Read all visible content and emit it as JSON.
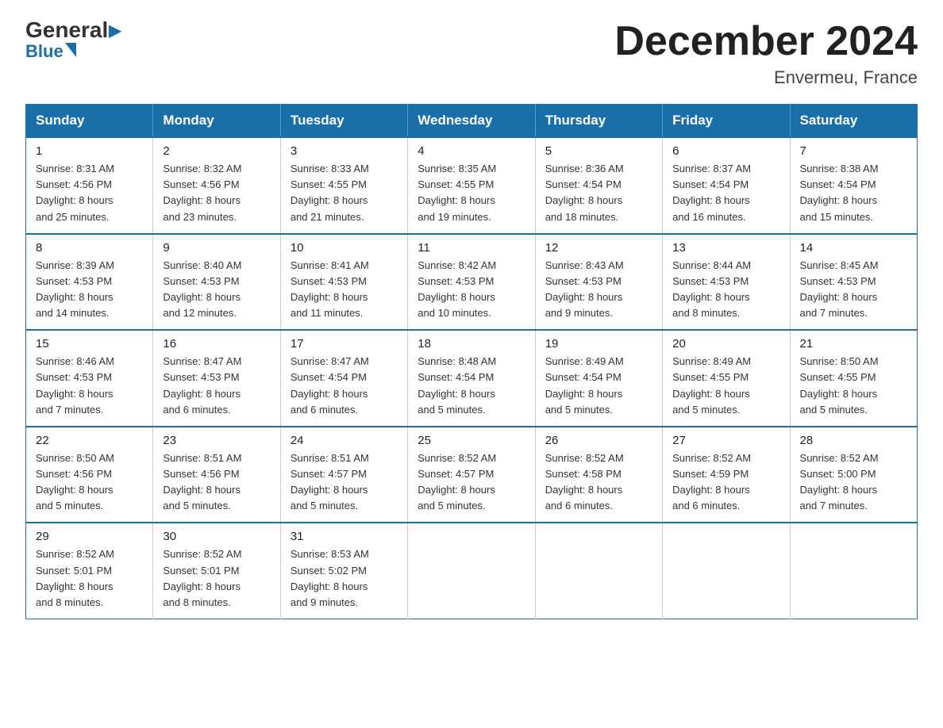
{
  "logo": {
    "general": "General",
    "blue_text": "Blue",
    "triangle": true
  },
  "title": {
    "month_year": "December 2024",
    "location": "Envermeu, France"
  },
  "days_of_week": [
    "Sunday",
    "Monday",
    "Tuesday",
    "Wednesday",
    "Thursday",
    "Friday",
    "Saturday"
  ],
  "weeks": [
    [
      {
        "day": "1",
        "sunrise": "8:31 AM",
        "sunset": "4:56 PM",
        "daylight": "8 hours and 25 minutes."
      },
      {
        "day": "2",
        "sunrise": "8:32 AM",
        "sunset": "4:56 PM",
        "daylight": "8 hours and 23 minutes."
      },
      {
        "day": "3",
        "sunrise": "8:33 AM",
        "sunset": "4:55 PM",
        "daylight": "8 hours and 21 minutes."
      },
      {
        "day": "4",
        "sunrise": "8:35 AM",
        "sunset": "4:55 PM",
        "daylight": "8 hours and 19 minutes."
      },
      {
        "day": "5",
        "sunrise": "8:36 AM",
        "sunset": "4:54 PM",
        "daylight": "8 hours and 18 minutes."
      },
      {
        "day": "6",
        "sunrise": "8:37 AM",
        "sunset": "4:54 PM",
        "daylight": "8 hours and 16 minutes."
      },
      {
        "day": "7",
        "sunrise": "8:38 AM",
        "sunset": "4:54 PM",
        "daylight": "8 hours and 15 minutes."
      }
    ],
    [
      {
        "day": "8",
        "sunrise": "8:39 AM",
        "sunset": "4:53 PM",
        "daylight": "8 hours and 14 minutes."
      },
      {
        "day": "9",
        "sunrise": "8:40 AM",
        "sunset": "4:53 PM",
        "daylight": "8 hours and 12 minutes."
      },
      {
        "day": "10",
        "sunrise": "8:41 AM",
        "sunset": "4:53 PM",
        "daylight": "8 hours and 11 minutes."
      },
      {
        "day": "11",
        "sunrise": "8:42 AM",
        "sunset": "4:53 PM",
        "daylight": "8 hours and 10 minutes."
      },
      {
        "day": "12",
        "sunrise": "8:43 AM",
        "sunset": "4:53 PM",
        "daylight": "8 hours and 9 minutes."
      },
      {
        "day": "13",
        "sunrise": "8:44 AM",
        "sunset": "4:53 PM",
        "daylight": "8 hours and 8 minutes."
      },
      {
        "day": "14",
        "sunrise": "8:45 AM",
        "sunset": "4:53 PM",
        "daylight": "8 hours and 7 minutes."
      }
    ],
    [
      {
        "day": "15",
        "sunrise": "8:46 AM",
        "sunset": "4:53 PM",
        "daylight": "8 hours and 7 minutes."
      },
      {
        "day": "16",
        "sunrise": "8:47 AM",
        "sunset": "4:53 PM",
        "daylight": "8 hours and 6 minutes."
      },
      {
        "day": "17",
        "sunrise": "8:47 AM",
        "sunset": "4:54 PM",
        "daylight": "8 hours and 6 minutes."
      },
      {
        "day": "18",
        "sunrise": "8:48 AM",
        "sunset": "4:54 PM",
        "daylight": "8 hours and 5 minutes."
      },
      {
        "day": "19",
        "sunrise": "8:49 AM",
        "sunset": "4:54 PM",
        "daylight": "8 hours and 5 minutes."
      },
      {
        "day": "20",
        "sunrise": "8:49 AM",
        "sunset": "4:55 PM",
        "daylight": "8 hours and 5 minutes."
      },
      {
        "day": "21",
        "sunrise": "8:50 AM",
        "sunset": "4:55 PM",
        "daylight": "8 hours and 5 minutes."
      }
    ],
    [
      {
        "day": "22",
        "sunrise": "8:50 AM",
        "sunset": "4:56 PM",
        "daylight": "8 hours and 5 minutes."
      },
      {
        "day": "23",
        "sunrise": "8:51 AM",
        "sunset": "4:56 PM",
        "daylight": "8 hours and 5 minutes."
      },
      {
        "day": "24",
        "sunrise": "8:51 AM",
        "sunset": "4:57 PM",
        "daylight": "8 hours and 5 minutes."
      },
      {
        "day": "25",
        "sunrise": "8:52 AM",
        "sunset": "4:57 PM",
        "daylight": "8 hours and 5 minutes."
      },
      {
        "day": "26",
        "sunrise": "8:52 AM",
        "sunset": "4:58 PM",
        "daylight": "8 hours and 6 minutes."
      },
      {
        "day": "27",
        "sunrise": "8:52 AM",
        "sunset": "4:59 PM",
        "daylight": "8 hours and 6 minutes."
      },
      {
        "day": "28",
        "sunrise": "8:52 AM",
        "sunset": "5:00 PM",
        "daylight": "8 hours and 7 minutes."
      }
    ],
    [
      {
        "day": "29",
        "sunrise": "8:52 AM",
        "sunset": "5:01 PM",
        "daylight": "8 hours and 8 minutes."
      },
      {
        "day": "30",
        "sunrise": "8:52 AM",
        "sunset": "5:01 PM",
        "daylight": "8 hours and 8 minutes."
      },
      {
        "day": "31",
        "sunrise": "8:53 AM",
        "sunset": "5:02 PM",
        "daylight": "8 hours and 9 minutes."
      },
      null,
      null,
      null,
      null
    ]
  ],
  "labels": {
    "sunrise_prefix": "Sunrise: ",
    "sunset_prefix": "Sunset: ",
    "daylight_prefix": "Daylight: "
  }
}
